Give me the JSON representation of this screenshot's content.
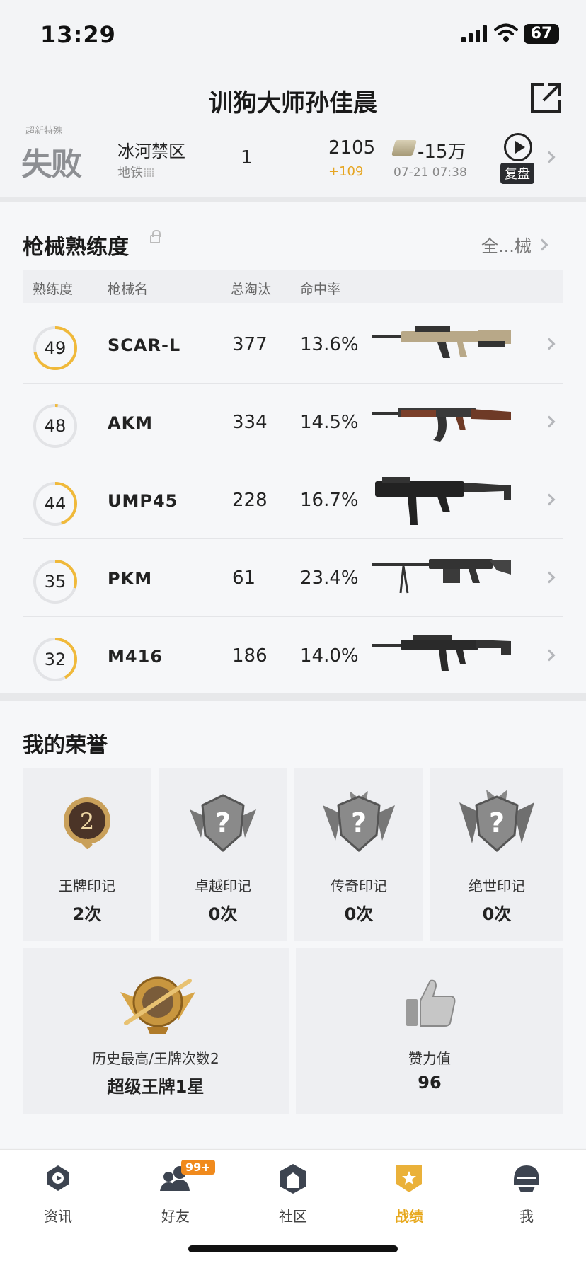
{
  "status_bar": {
    "time": "13:29",
    "battery": "67"
  },
  "header": {
    "title": "训狗大师孙佳晨"
  },
  "last_match": {
    "top_label": "超新特殊",
    "result": "失败",
    "map": "冰河禁区",
    "mode": "地铁",
    "mode_dots": "⁞⁞⁞⁞",
    "rank": "1",
    "score": "2105",
    "score_delta": "+109",
    "money": "-15万",
    "datetime": "07-21 07:38",
    "replay_label": "复盘"
  },
  "weapons": {
    "title": "枪械熟练度",
    "all_link": "全...械",
    "columns": [
      "熟练度",
      "枪械名",
      "总淘汰",
      "命中率"
    ],
    "rows": [
      {
        "level": "49",
        "name": "SCAR-L",
        "kills": "377",
        "accuracy": "13.6%",
        "progress": 0.72
      },
      {
        "level": "48",
        "name": "AKM",
        "kills": "334",
        "accuracy": "14.5%",
        "progress": 0.02
      },
      {
        "level": "44",
        "name": "UMP45",
        "kills": "228",
        "accuracy": "16.7%",
        "progress": 0.45
      },
      {
        "level": "35",
        "name": "PKM",
        "kills": "61",
        "accuracy": "23.4%",
        "progress": 0.3
      },
      {
        "level": "32",
        "name": "M416",
        "kills": "186",
        "accuracy": "14.0%",
        "progress": 0.42
      }
    ]
  },
  "honors": {
    "title": "我的荣誉",
    "badges": [
      {
        "label": "王牌印记",
        "count": "2次"
      },
      {
        "label": "卓越印记",
        "count": "0次"
      },
      {
        "label": "传奇印记",
        "count": "0次"
      },
      {
        "label": "绝世印记",
        "count": "0次"
      }
    ],
    "best": {
      "label": "历史最高/王牌次数2",
      "value": "超级王牌1星"
    },
    "likes": {
      "label": "赞力值",
      "value": "96"
    }
  },
  "tabbar": {
    "tabs": [
      {
        "label": "资讯"
      },
      {
        "label": "好友"
      },
      {
        "label": "社区"
      },
      {
        "label": "战绩"
      },
      {
        "label": "我"
      }
    ],
    "friends_badge": "99+",
    "active": "战绩",
    "accent": "#e7a81d"
  }
}
